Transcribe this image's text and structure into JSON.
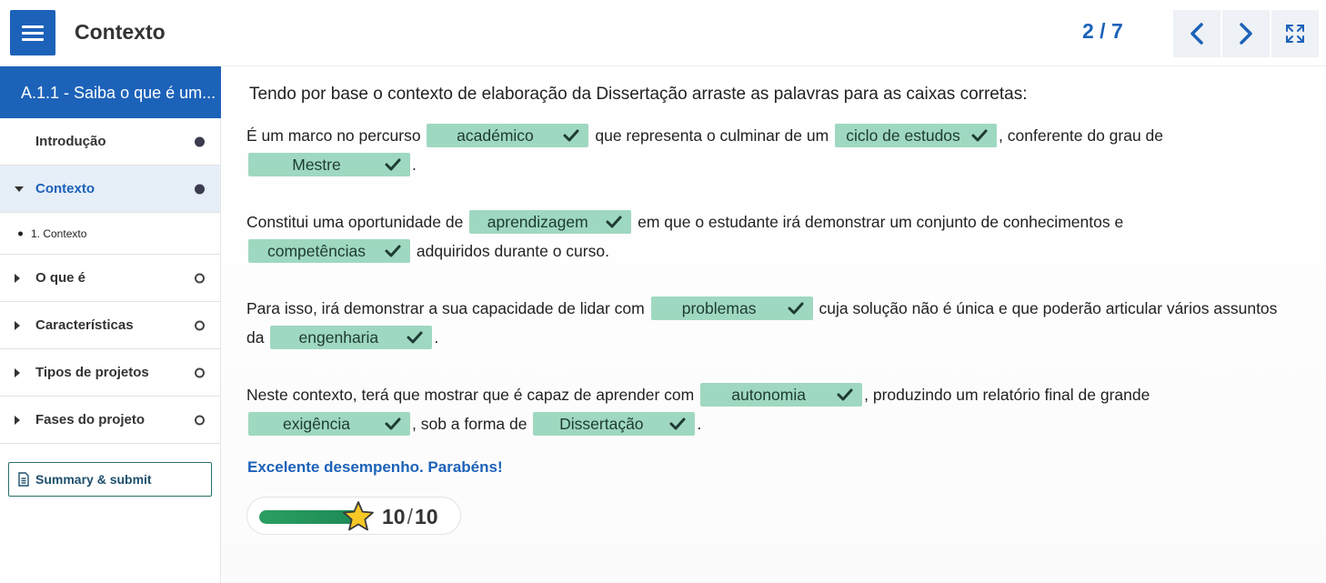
{
  "header": {
    "title": "Contexto",
    "counter": "2 / 7",
    "colors": {
      "accent": "#1c62b9",
      "chip": "#9fd8c0",
      "progress": "#2a9e62"
    }
  },
  "sidebar": {
    "head": "A.1.1 - Saiba o que é um...",
    "items": [
      {
        "label": "Introdução",
        "status": "complete"
      },
      {
        "label": "Contexto",
        "status": "complete"
      },
      {
        "label": "1. Contexto"
      },
      {
        "label": "O que é",
        "status": "incomplete"
      },
      {
        "label": "Características",
        "status": "incomplete"
      },
      {
        "label": "Tipos de projetos",
        "status": "incomplete"
      },
      {
        "label": "Fases do projeto",
        "status": "incomplete"
      }
    ],
    "summary_label": "Summary & submit"
  },
  "main": {
    "prompt": "Tendo por base o contexto de elaboração da Dissertação arraste as palavras para as caixas corretas:",
    "p1": {
      "a": "É um marco no percurso",
      "w1": "académico",
      "b": "que representa o culminar de um",
      "w2": "ciclo de estudos",
      "c": ", conferente do grau de",
      "w3": "Mestre",
      "d": "."
    },
    "p2": {
      "a": "Constitui uma oportunidade de",
      "w1": "aprendizagem",
      "b": "em que o estudante irá demonstrar um conjunto de conhecimentos e",
      "w2": "competências",
      "c": "adquiridos durante o curso."
    },
    "p3": {
      "a": "Para isso, irá demonstrar a sua capacidade de lidar com",
      "w1": "problemas",
      "b": "cuja solução não é única e que poderão articular vários assuntos da",
      "w2": "engenharia",
      "c": "."
    },
    "p4": {
      "a": "Neste contexto, terá que mostrar que é capaz de aprender com",
      "w1": "autonomia",
      "b": ", produzindo um relatório final de grande",
      "w2": "exigência",
      "c": ", sob a forma de",
      "w3": "Dissertação",
      "d": "."
    },
    "feedback": "Excelente desempenho. Parabéns!",
    "score": {
      "value": "10",
      "max": "10",
      "fraction": 1.0
    }
  },
  "icons": {
    "menu": "hamburger-icon",
    "prev": "chevron-left-icon",
    "next": "chevron-right-icon",
    "fullscreen": "expand-icon",
    "check": "check-icon",
    "star": "star-icon",
    "summary": "document-icon"
  }
}
